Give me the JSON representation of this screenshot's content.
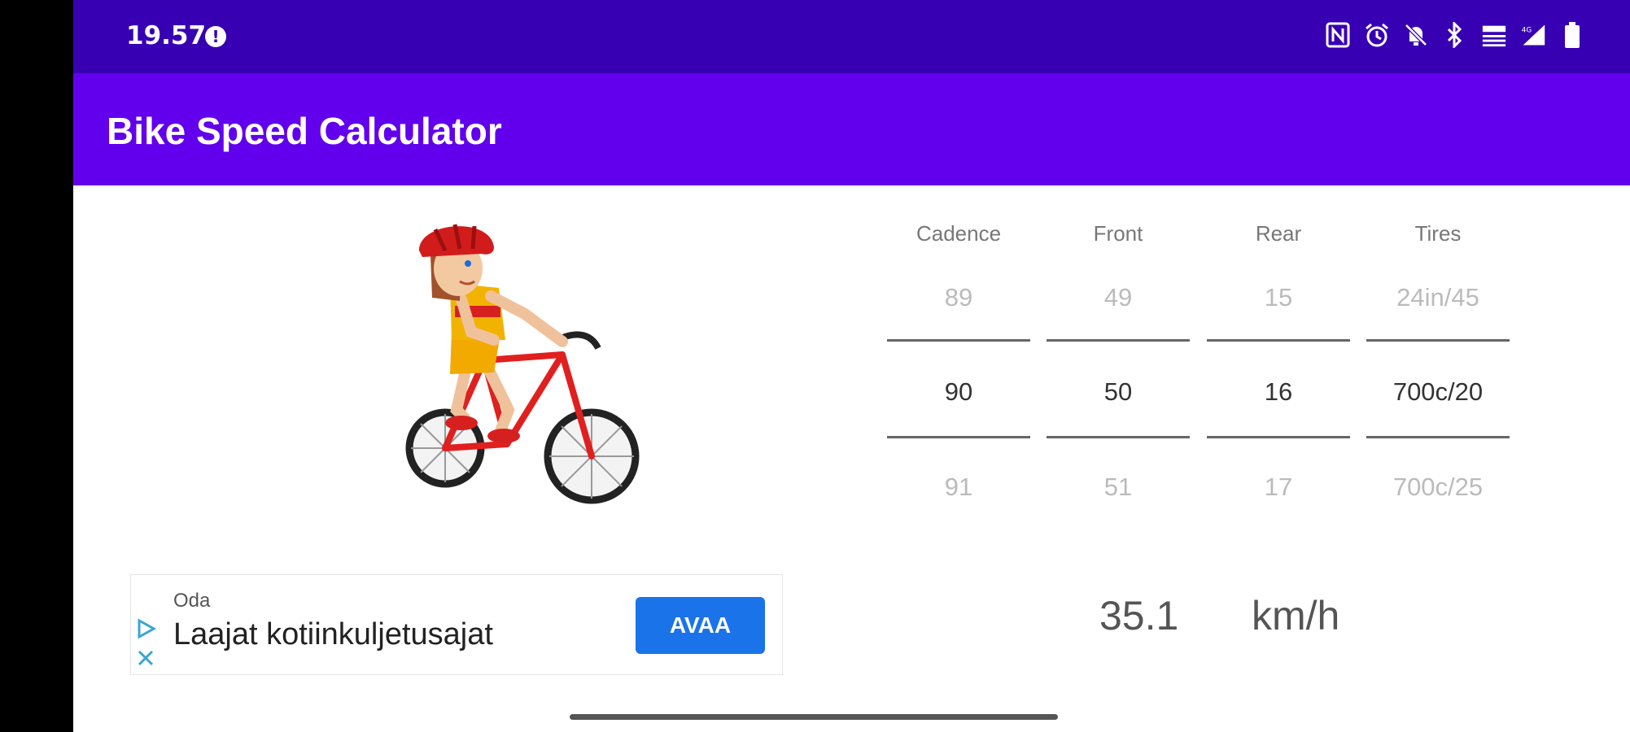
{
  "status_bar": {
    "time": "19.57",
    "alert_glyph": "!",
    "icons": [
      "nfc-icon",
      "alarm-icon",
      "mute-icon",
      "bluetooth-icon",
      "data-speed-icon",
      "signal-icon",
      "battery-icon"
    ],
    "bg_color": "#3700b3"
  },
  "app_bar": {
    "title": "Bike Speed Calculator",
    "bg_color": "#6200ee"
  },
  "image": {
    "alt": "cyclist-illustration"
  },
  "ad": {
    "advertiser": "Oda",
    "headline": "Laajat kotiinkuljetusajat",
    "button_label": "AVAA",
    "button_color": "#1a73e8"
  },
  "pickers": [
    {
      "label": "Cadence",
      "prev": "89",
      "current": "90",
      "next": "91"
    },
    {
      "label": "Front",
      "prev": "49",
      "current": "50",
      "next": "51"
    },
    {
      "label": "Rear",
      "prev": "15",
      "current": "16",
      "next": "17"
    },
    {
      "label": "Tires",
      "prev": "24in/45",
      "current": "700c/20",
      "next": "700c/25"
    }
  ],
  "result": {
    "speed": "35.1",
    "unit": "km/h"
  }
}
